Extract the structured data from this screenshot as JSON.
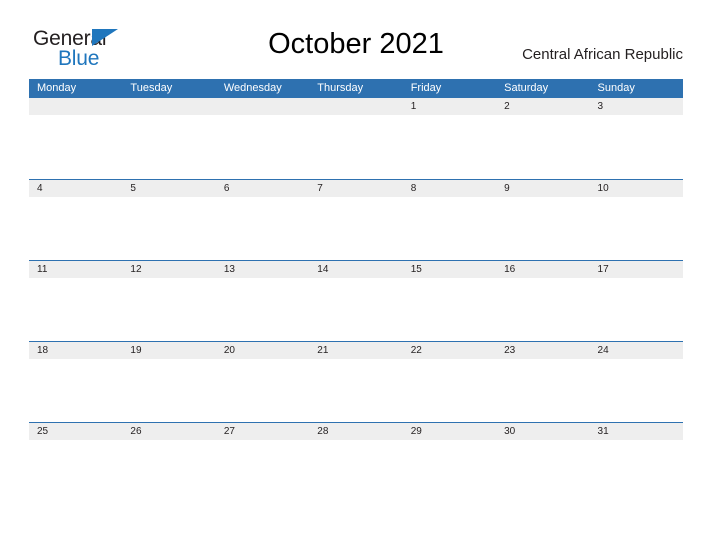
{
  "logo": {
    "word_dark": "General",
    "word_blue": "Blue",
    "triangle_icon": "logo-triangle-icon",
    "color_blue": "#1f76bd",
    "color_dark": "#231f20"
  },
  "header": {
    "title": "October 2021",
    "country": "Central African Republic"
  },
  "calendar": {
    "month": "October",
    "year": "2021",
    "header_bg": "#2e71b0",
    "daynum_bg": "#eeeeee",
    "weekday_headers": [
      "Monday",
      "Tuesday",
      "Wednesday",
      "Thursday",
      "Friday",
      "Saturday",
      "Sunday"
    ],
    "weeks": [
      [
        "",
        "",
        "",
        "",
        "1",
        "2",
        "3"
      ],
      [
        "4",
        "5",
        "6",
        "7",
        "8",
        "9",
        "10"
      ],
      [
        "11",
        "12",
        "13",
        "14",
        "15",
        "16",
        "17"
      ],
      [
        "18",
        "19",
        "20",
        "21",
        "22",
        "23",
        "24"
      ],
      [
        "25",
        "26",
        "27",
        "28",
        "29",
        "30",
        "31"
      ]
    ]
  }
}
